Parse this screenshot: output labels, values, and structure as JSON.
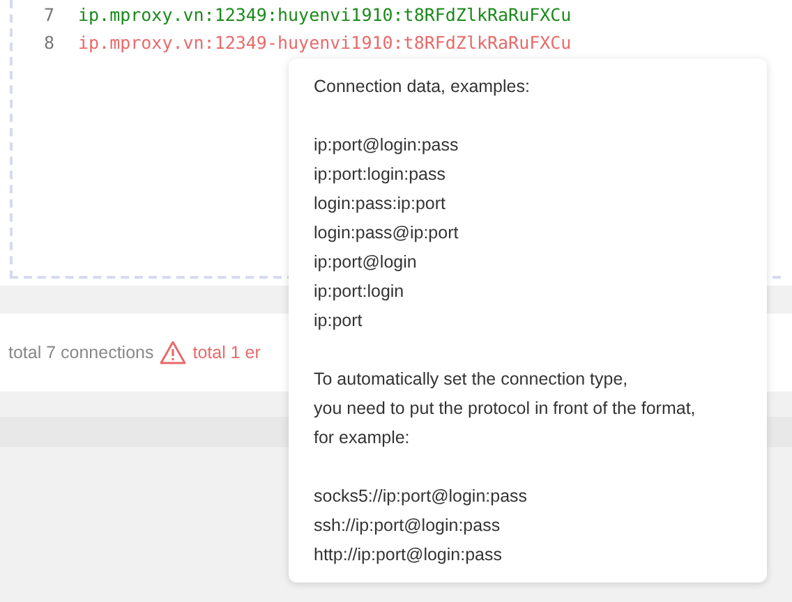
{
  "editor": {
    "lines": [
      {
        "number": "7",
        "text": "ip.mproxy.vn:12349:huyenvi1910:t8RFdZlkRaRuFXCu",
        "kind": "valid"
      },
      {
        "number": "8",
        "text": "ip.mproxy.vn:12349-huyenvi1910:t8RFdZlkRaRuFXCu",
        "kind": "error"
      }
    ]
  },
  "status_bar": {
    "total": "total 7 connections",
    "errors": "total 1 er"
  },
  "tooltip": {
    "title": "Connection data, examples:",
    "formats": [
      "ip:port@login:pass",
      "ip:port:login:pass",
      "login:pass:ip:port",
      "login:pass@ip:port",
      "ip:port@login",
      "ip:port:login",
      "ip:port"
    ],
    "note_lines": [
      "To automatically set the connection type,",
      "you need to put the protocol in front of the format,",
      "for example:"
    ],
    "examples": [
      "socks5://ip:port@login:pass",
      "ssh://ip:port@login:pass",
      "http://ip:port@login:pass"
    ]
  }
}
